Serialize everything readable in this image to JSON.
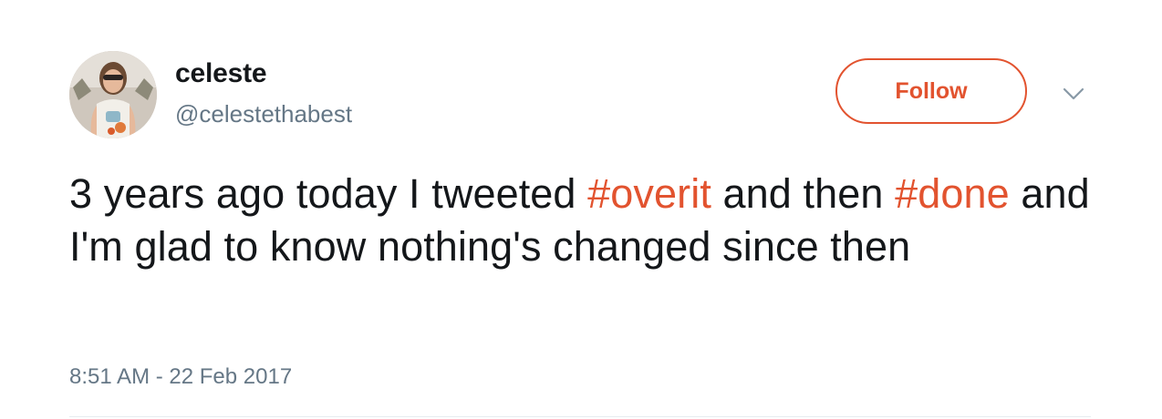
{
  "user": {
    "display_name": "celeste",
    "handle": "@celestethabest"
  },
  "actions": {
    "follow_label": "Follow",
    "more_icon": "chevron-down-icon"
  },
  "tweet": {
    "segments": [
      {
        "type": "text",
        "value": "3 years ago today I tweeted "
      },
      {
        "type": "hashtag",
        "value": "#overit"
      },
      {
        "type": "text",
        "value": " and then "
      },
      {
        "type": "hashtag",
        "value": "#done"
      },
      {
        "type": "text",
        "value": " and I'm glad to know nothing's changed since then"
      }
    ],
    "timestamp": "8:51 AM - 22 Feb 2017"
  },
  "colors": {
    "accent": "#e2532f",
    "text": "#14171a",
    "secondary": "#657786",
    "divider": "#e6ecf0"
  }
}
